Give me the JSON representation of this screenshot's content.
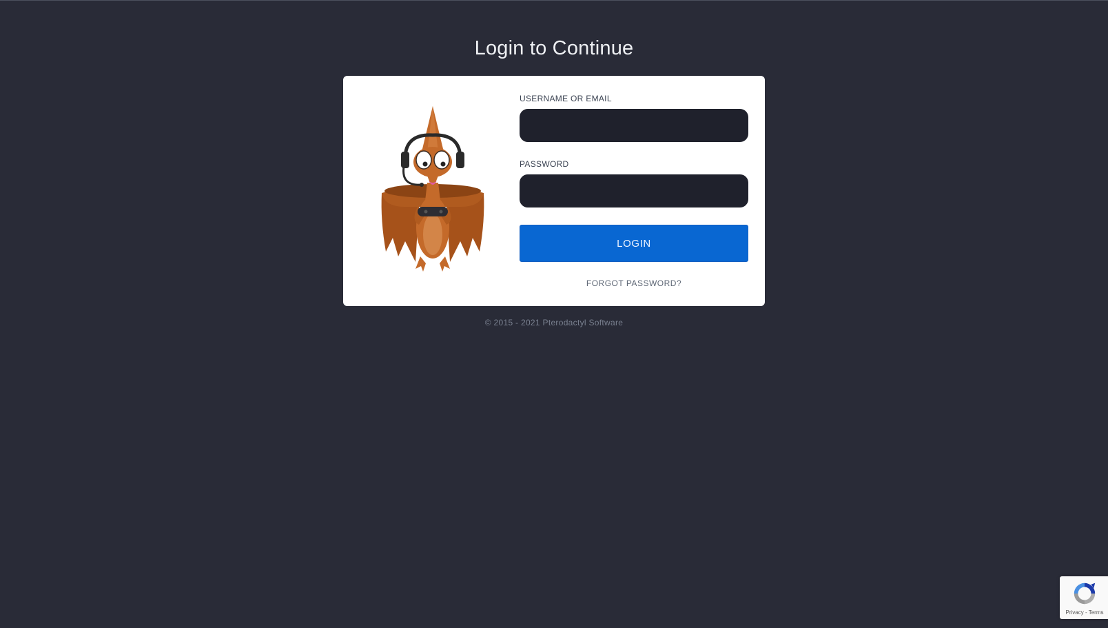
{
  "page": {
    "title": "Login to Continue",
    "footer": "© 2015 - 2021 Pterodactyl Software"
  },
  "form": {
    "username_label": "USERNAME OR EMAIL",
    "username_value": "",
    "password_label": "PASSWORD",
    "password_value": "",
    "login_button": "LOGIN",
    "forgot_link": "FORGOT PASSWORD?"
  },
  "recaptcha": {
    "privacy": "Privacy",
    "separator": " - ",
    "terms": "Terms"
  },
  "colors": {
    "background": "#292b37",
    "card": "#ffffff",
    "input": "#1f212c",
    "primary": "#0967d2",
    "mascot_body": "#c46a2a"
  },
  "icons": {
    "mascot": "pterodactyl-gamer-mascot",
    "recaptcha": "recaptcha-icon"
  }
}
